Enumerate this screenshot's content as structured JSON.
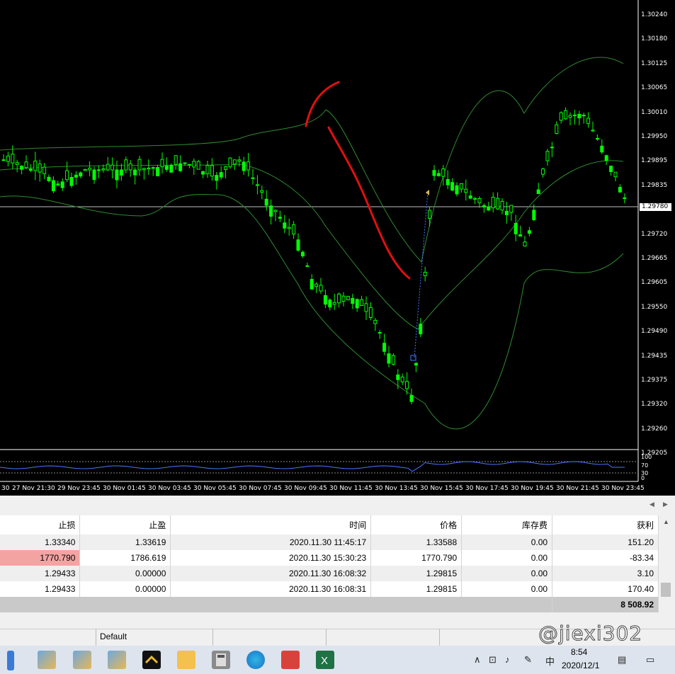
{
  "chart": {
    "price_labels": [
      "1.30240",
      "1.30180",
      "1.30125",
      "1.30065",
      "1.30010",
      "1.29950",
      "1.29895",
      "1.29835",
      "1.29780",
      "1.29720",
      "1.29665",
      "1.29605",
      "1.29550",
      "1.29490",
      "1.29435",
      "1.29375",
      "1.29320",
      "1.29260",
      "1.29205"
    ],
    "current_price": "1.29780",
    "indicator_labels": [
      "100",
      "70",
      "30",
      "0"
    ],
    "time_labels": [
      "30",
      "27 Nov 21:30",
      "29 Nov 23:45",
      "30 Nov 01:45",
      "30 Nov 03:45",
      "30 Nov 05:45",
      "30 Nov 07:45",
      "30 Nov 09:45",
      "30 Nov 11:45",
      "30 Nov 13:45",
      "30 Nov 15:45",
      "30 Nov 17:45",
      "30 Nov 19:45",
      "30 Nov 21:45",
      "30 Nov 23:45"
    ],
    "colors": {
      "candle": "#00ff00",
      "band": "#2e8b2e",
      "annotation": "#e01010",
      "indicator": "#4a78ff",
      "grid_line": "#c0c0c0"
    }
  },
  "table": {
    "headers": [
      "止损",
      "止盈",
      "时间",
      "价格",
      "库存费",
      "获利"
    ],
    "rows": [
      [
        "1.33340",
        "1.33619",
        "2020.11.30 11:45:17",
        "1.33588",
        "0.00",
        "151.20"
      ],
      [
        "1770.790",
        "1786.619",
        "2020.11.30 15:30:23",
        "1770.790",
        "0.00",
        "-83.34"
      ],
      [
        "1.29433",
        "0.00000",
        "2020.11.30 16:08:32",
        "1.29815",
        "0.00",
        "3.10"
      ],
      [
        "1.29433",
        "0.00000",
        "2020.11.30 16:08:31",
        "1.29815",
        "0.00",
        "170.40"
      ]
    ],
    "total": "8 508.92"
  },
  "status_bar": {
    "profile": "Default"
  },
  "watermark": {
    "text": "@jiexi302"
  },
  "taskbar": {
    "time": "8:54",
    "date": "2020/12/1",
    "ime": "中",
    "icons": [
      "network-icon",
      "user-app-icon",
      "user-app-icon",
      "forex-app-icon",
      "file-explorer-icon",
      "calculator-icon",
      "edge-browser-icon",
      "tools-app-icon",
      "excel-icon"
    ]
  }
}
